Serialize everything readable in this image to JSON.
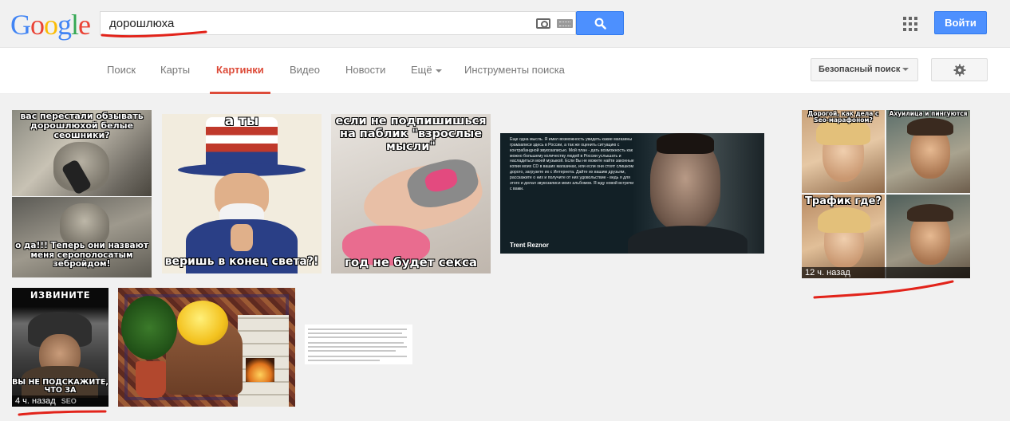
{
  "logo": "Google",
  "search": {
    "query": "дорошлюха"
  },
  "header": {
    "login_label": "Войти"
  },
  "nav": {
    "items": [
      {
        "label": "Поиск"
      },
      {
        "label": "Карты"
      },
      {
        "label": "Картинки"
      },
      {
        "label": "Видео"
      },
      {
        "label": "Новости"
      },
      {
        "label": "Ещё"
      },
      {
        "label": "Инструменты поиска"
      }
    ],
    "safe_search_label": "Безопасный поиск"
  },
  "results": {
    "cat_top_caption": "вас перестали обзывать дорошлюхой белые сеошники?",
    "cat_bottom_caption": "о да!!! Теперь они назвают меня серополосатым зебройдом!",
    "unclesam_top": "а ты",
    "unclesam_bottom": "веришь в конец света?!",
    "girl_top": "если не подпишишься на паблик \"взрослые мысли\"",
    "girl_bottom": "год не будет секса",
    "reznor_text": "Еще одна мысль. Я имел возможность увидеть какие магазины грамзаписи здесь в России, а так же оценить ситуацию с контрабандной звукозаписью. Мой план - дать возможность как можно большему количеству людей в России услышать и насладиться моей музыкой. Если Вы не можете найти законные копии моих CD в ваших магазинах, или если они стоят слишком дорого, загрузите их с Интернета. Дайте их вашим друзьям, расскажите о них и получите от них удовольствие - ведь я для этого и делал звукозаписи моих альбомов. Я жду новой встречи с вами.",
    "reznor_signature": "Trent Reznor",
    "collage_q1": "Дорогой, как дела с Sео-марафоном?",
    "collage_q2": "Ахуилица и пингуются",
    "collage_q3": "Трафик где?",
    "collage_time": "12 ч. назад",
    "izvinite_top": "ИЗВИНИТЕ",
    "izvinite_bottom": "ВЫ НЕ ПОДСКАЖИТЕ, ЧТО ЗА",
    "izvinite_tail": "SEO ТАКОЙ?",
    "izvinite_time": "4 ч. назад"
  }
}
